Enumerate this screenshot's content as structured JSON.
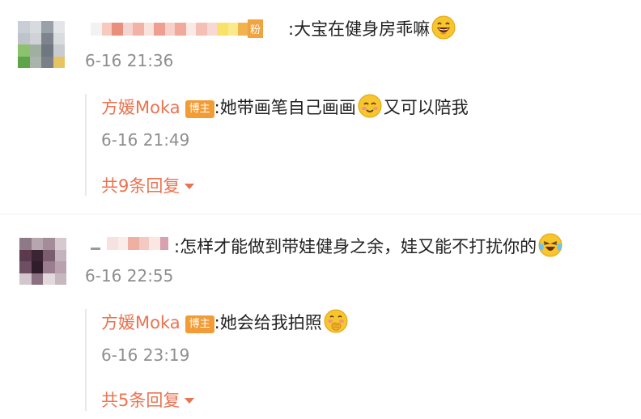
{
  "comments": [
    {
      "text": ":大宝在健身房乖嘛",
      "emoji": "laughing-emoji",
      "timestamp": "6-16 21:36",
      "mosaic_tail": "粉",
      "reply": {
        "author": "方媛Moka",
        "badge": "博主",
        "text": ":她带画笔自己画画",
        "emoji": "blush-emoji",
        "text_after": "又可以陪我",
        "timestamp": "6-16 21:49",
        "more": "共9条回复"
      }
    },
    {
      "text": ":怎样才能做到带娃健身之余，娃又能不打扰你的",
      "emoji": "crying-laughing-emoji",
      "timestamp": "6-16 22:55",
      "reply": {
        "author": "方媛Moka",
        "badge": "博主",
        "text": ":她会给我拍照",
        "emoji": "shy-giggle-emoji",
        "timestamp": "6-16 23:19",
        "more": "共5条回复"
      }
    }
  ],
  "colors": {
    "accent": "#eb7350",
    "badge": "#f39b35",
    "muted": "#8e8e8e"
  }
}
